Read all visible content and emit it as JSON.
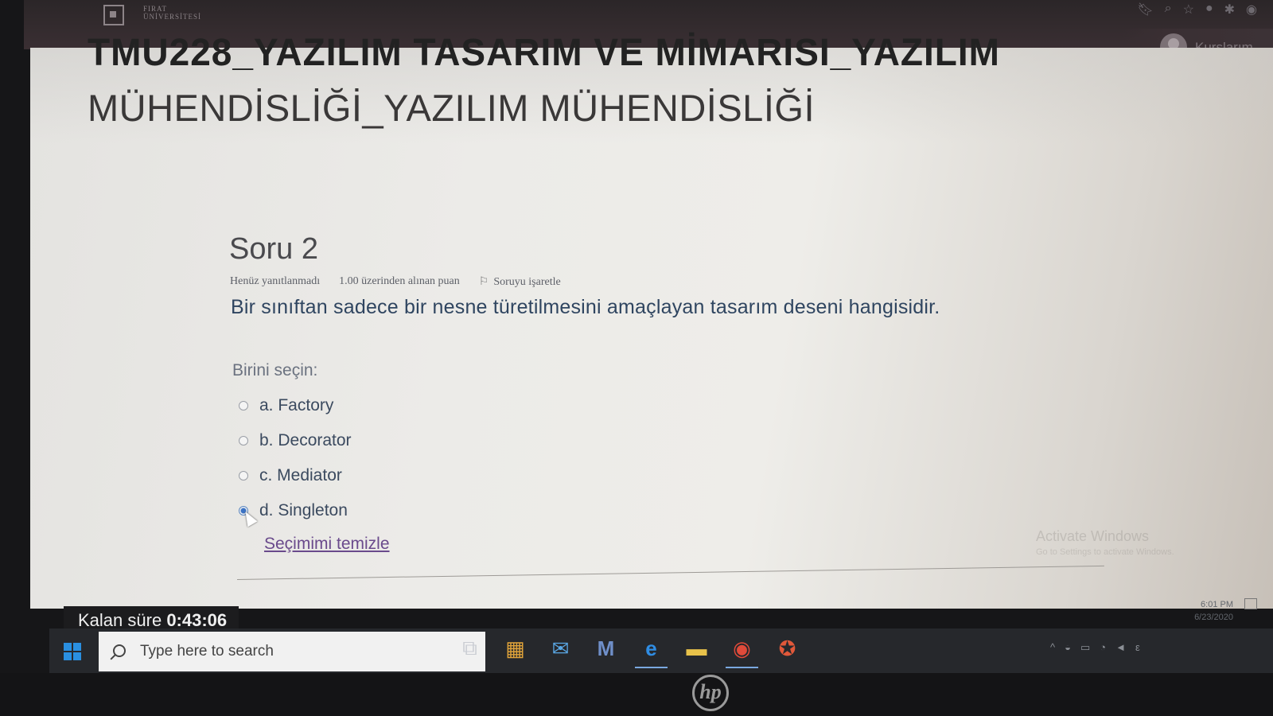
{
  "browser": {
    "logo_text_line1": "FIRAT",
    "logo_text_line2": "ÜNİVERSİTESİ",
    "user_label": "Kurslarım"
  },
  "course": {
    "title_partial": "TMU228_YAZILIM TASARIM VE MİMARISI_YAZILIM",
    "title_line2": "MÜHENDİSLİĞİ_YAZILIM MÜHENDİSLİĞİ"
  },
  "question": {
    "title": "Soru 2",
    "status": "Henüz yanıtlanmadı",
    "points": "1.00 üzerinden alınan puan",
    "flag_label": "Soruyu işaretle",
    "text": "Bir sınıftan sadece bir nesne türetilmesini amaçlayan tasarım deseni hangisidir.",
    "prompt": "Birini seçin:",
    "options": [
      {
        "label": "a. Factory",
        "checked": false
      },
      {
        "label": "b. Decorator",
        "checked": false
      },
      {
        "label": "c. Mediator",
        "checked": false
      },
      {
        "label": "d. Singleton",
        "checked": true
      }
    ],
    "clear_label": "Seçimimi temizle"
  },
  "timer": {
    "label": "Kalan süre",
    "value": "0:43:06"
  },
  "watermark": {
    "title": "Activate Windows",
    "subtitle": "Go to Settings to activate Windows."
  },
  "taskbar": {
    "search_placeholder": "Type here to search",
    "apps": [
      "task-view-icon",
      "store-icon",
      "mail-icon",
      "m-app-icon",
      "edge-icon",
      "file-explorer-icon",
      "chrome-icon",
      "autocad-icon"
    ],
    "time": "6:01 PM",
    "date": "6/23/2020"
  },
  "monitor": {
    "brand": "hp"
  }
}
